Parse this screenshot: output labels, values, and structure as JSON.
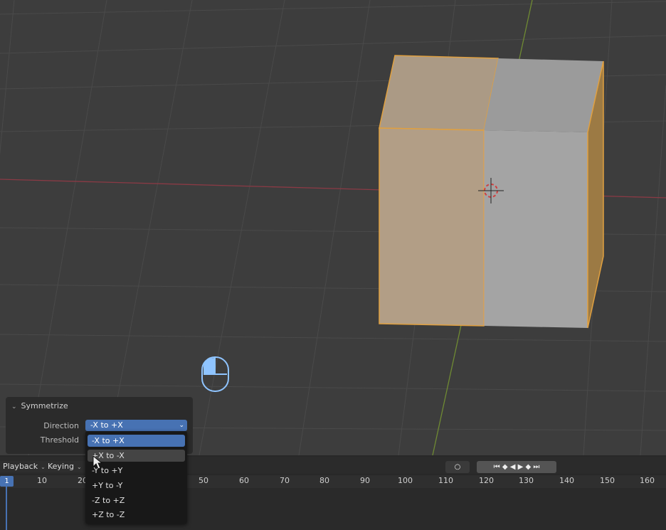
{
  "panel": {
    "title": "Symmetrize",
    "direction_label": "Direction",
    "threshold_label": "Threshold",
    "direction_value": "-X to +X"
  },
  "dropdown": {
    "items": [
      "-X to +X",
      "+X to -X",
      "-Y to +Y",
      "+Y to -Y",
      "-Z to +Z",
      "+Z to -Z"
    ],
    "selected": "-X to +X",
    "hovered": "+X to -X"
  },
  "timeline": {
    "playback_label": "Playback",
    "keying_label": "Keying",
    "current_frame": "1",
    "ruler_ticks": [
      "10",
      "20",
      "50",
      "60",
      "70",
      "80",
      "90",
      "100",
      "110",
      "120",
      "130",
      "140",
      "150",
      "160"
    ]
  },
  "colors": {
    "accent": "#4772b3",
    "selection_outline": "#e0a040"
  }
}
